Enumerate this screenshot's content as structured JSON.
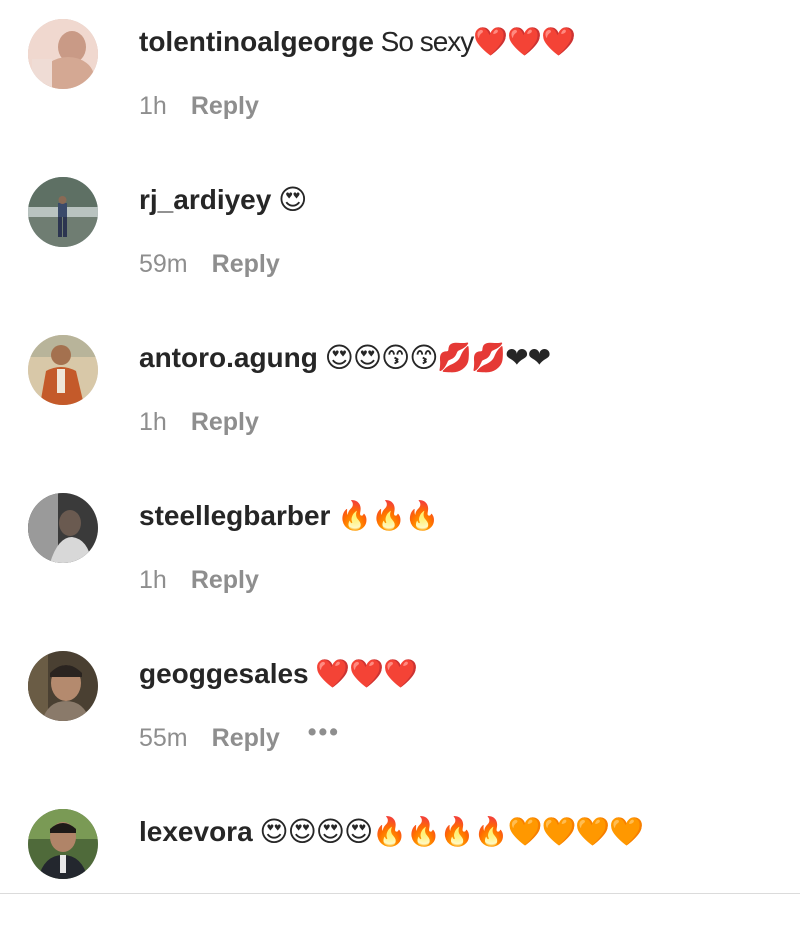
{
  "comments": [
    {
      "username": "tolentinoalgeorge",
      "text": " So sexy❤️❤️❤️",
      "time": "1h",
      "reply": "Reply",
      "avatar": "avatar-shirtless-man"
    },
    {
      "username": "rj_ardiyey",
      "text": " 😍",
      "time": "59m",
      "reply": "Reply",
      "avatar": "avatar-man-standing-outdoors"
    },
    {
      "username": "antoro.agung",
      "text": " 😍😍😙😙💋💋❤❤",
      "time": "1h",
      "reply": "Reply",
      "avatar": "avatar-man-orange-jacket"
    },
    {
      "username": "steellegbarber",
      "text": " 🔥🔥🔥",
      "time": "1h",
      "reply": "Reply",
      "avatar": "avatar-man-dark-photo"
    },
    {
      "username": "geoggesales",
      "text": " ❤️❤️❤️",
      "time": "55m",
      "reply": "Reply",
      "more": "•••",
      "avatar": "avatar-man-portrait"
    },
    {
      "username": "lexevora",
      "text": " 😍😍😍😍🔥🔥🔥🔥🧡🧡🧡🧡",
      "time": "",
      "reply": "",
      "avatar": "avatar-man-suit"
    }
  ]
}
